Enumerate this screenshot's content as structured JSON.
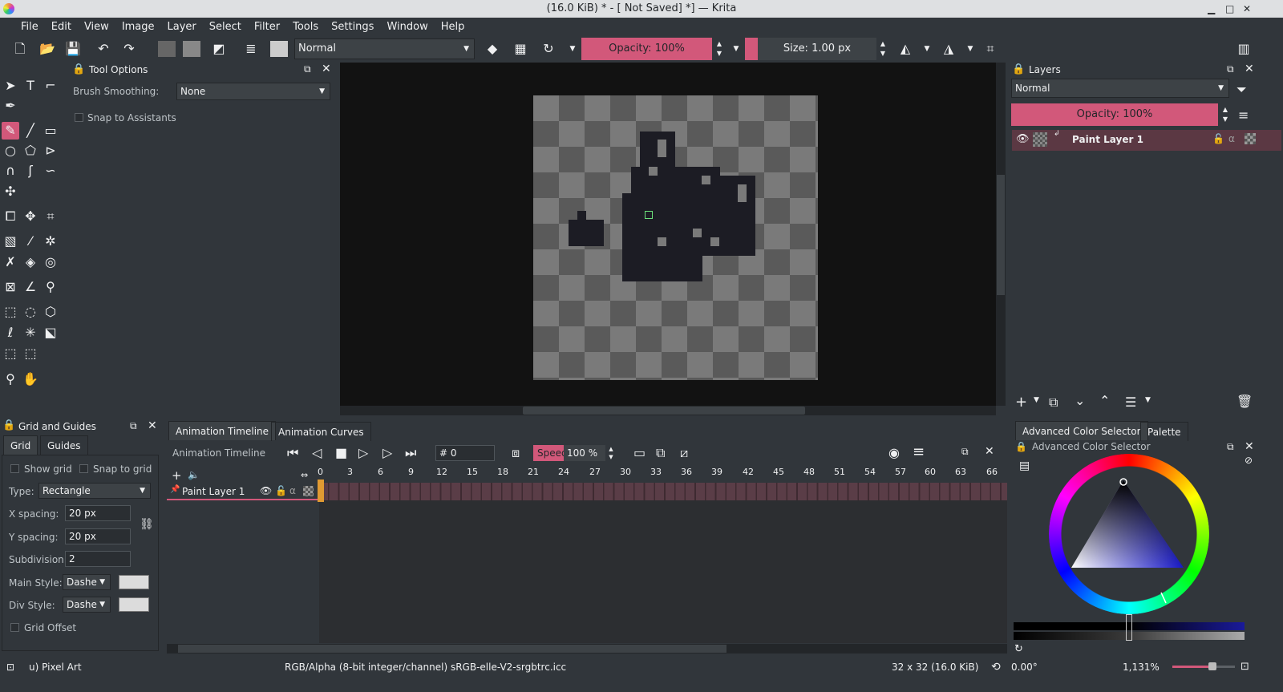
{
  "window": {
    "title": "(16.0 KiB)  * - [ Not Saved]  *] — Krita",
    "min": "▁",
    "max": "□",
    "close": "✕"
  },
  "menu": [
    "File",
    "Edit",
    "View",
    "Image",
    "Layer",
    "Select",
    "Filter",
    "Tools",
    "Settings",
    "Window",
    "Help"
  ],
  "toolbar": {
    "blend_mode": "Normal",
    "opacity": "Opacity: 100%",
    "size": "Size: 1.00 px"
  },
  "tool_options": {
    "title": "Tool Options",
    "brush_smoothing_label": "Brush Smoothing:",
    "brush_smoothing_value": "None",
    "snap_label": "Snap to Assistants"
  },
  "layers": {
    "title": "Layers",
    "blend_mode": "Normal",
    "opacity": "Opacity:  100%",
    "items": [
      {
        "name": "Paint Layer 1"
      }
    ]
  },
  "grid": {
    "title": "Grid and Guides",
    "tabs": [
      "Grid",
      "Guides"
    ],
    "show_grid": "Show grid",
    "snap_grid": "Snap to grid",
    "type_label": "Type:",
    "type_value": "Rectangle",
    "x_spacing_label": "X spacing:",
    "x_spacing": "20 px",
    "y_spacing_label": "Y spacing:",
    "y_spacing": "20 px",
    "subdivision_label": "Subdivision:",
    "subdivision": "2",
    "main_style_label": "Main Style:",
    "main_style": "Dashe",
    "div_style_label": "Div Style:",
    "div_style": "Dashe",
    "grid_offset": "Grid Offset"
  },
  "timeline": {
    "tabs": [
      "Animation Timeline",
      "Animation Curves"
    ],
    "title": "Animation Timeline",
    "frame": "# 0",
    "speed_label": "Speed:",
    "speed_value": "100 %",
    "ruler": [
      "0",
      "3",
      "6",
      "9",
      "12",
      "15",
      "18",
      "21",
      "24",
      "27",
      "30",
      "33",
      "36",
      "39",
      "42",
      "45",
      "48",
      "51",
      "54",
      "57",
      "60",
      "63",
      "66"
    ],
    "layer_name": "Paint Layer 1"
  },
  "color": {
    "tabs": [
      "Advanced Color Selector",
      "Palette"
    ],
    "title": "Advanced Color Selector"
  },
  "status": {
    "brush": "u) Pixel Art",
    "color_space": "RGB/Alpha (8-bit integer/channel)  sRGB-elle-V2-srgbtrc.icc",
    "dimensions": "32 x 32 (16.0 KiB)",
    "rotation": "0.00°",
    "zoom": "1,131%"
  },
  "colors": {
    "accent": "#d2587a",
    "paint": "#1c1c24"
  }
}
